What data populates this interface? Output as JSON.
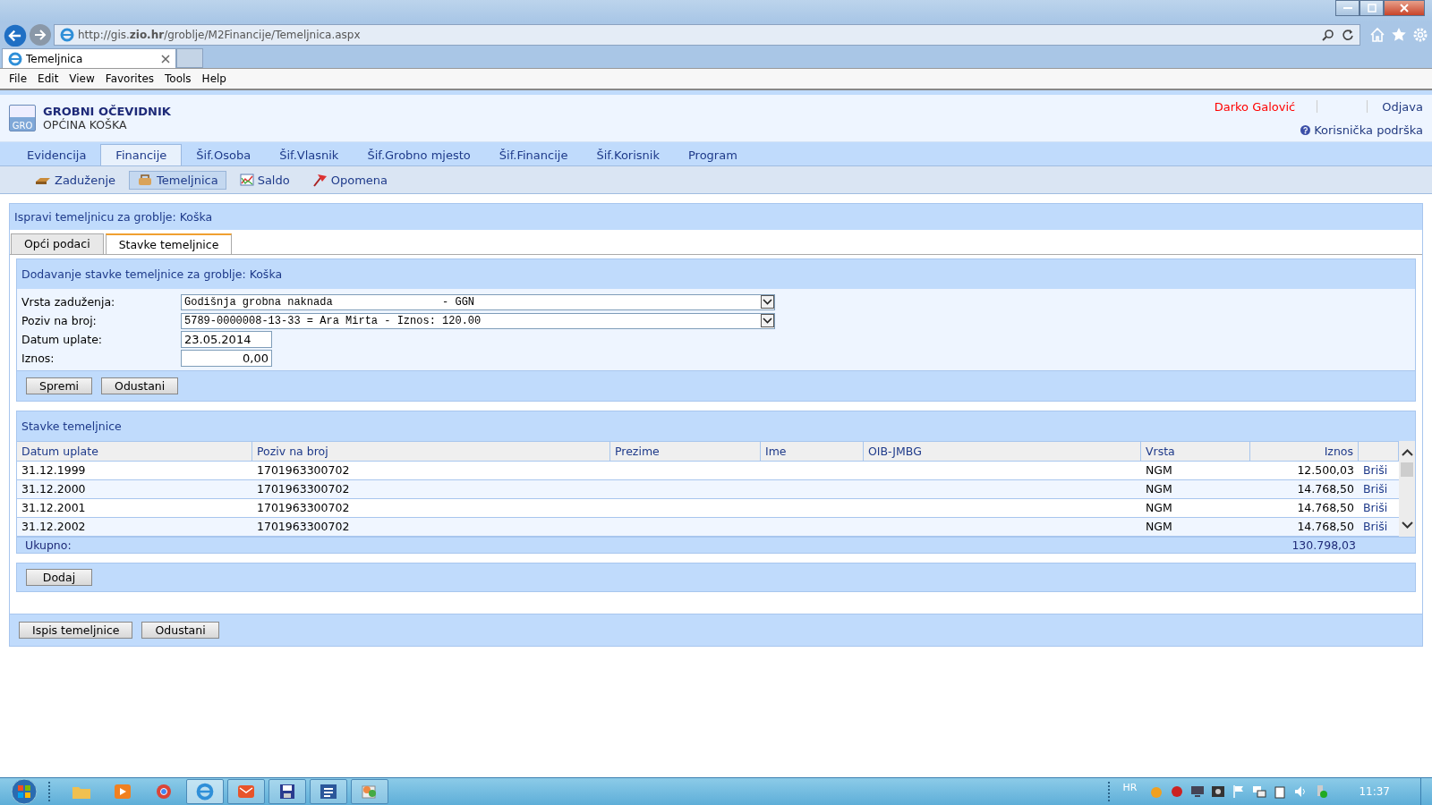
{
  "browser": {
    "url": "http://gis.**zio.hr**/groblje/M2Financije/Temeljnica.aspx",
    "tab_title": "Temeljnica",
    "menu": [
      "File",
      "Edit",
      "View",
      "Favorites",
      "Tools",
      "Help"
    ]
  },
  "app": {
    "title": "GROBNI OČEVIDNIK",
    "subtitle": "OPĆINA KOŠKA",
    "logo": "GRO",
    "user": "Darko Galović",
    "logout": "Odjava",
    "support": "Korisnička podrška"
  },
  "nav": [
    {
      "label": "Evidencija",
      "selected": false
    },
    {
      "label": "Financije",
      "selected": true
    },
    {
      "label": "Šif.Osoba",
      "selected": false
    },
    {
      "label": "Šif.Vlasnik",
      "selected": false
    },
    {
      "label": "Šif.Grobno mjesto",
      "selected": false
    },
    {
      "label": "Šif.Financije",
      "selected": false
    },
    {
      "label": "Šif.Korisnik",
      "selected": false
    },
    {
      "label": "Program",
      "selected": false
    }
  ],
  "subnav": [
    {
      "label": "Zaduženje",
      "selected": false
    },
    {
      "label": "Temeljnica",
      "selected": true
    },
    {
      "label": "Saldo",
      "selected": false
    },
    {
      "label": "Opomena",
      "selected": false
    }
  ],
  "page_title": "Ispravi temeljnicu za groblje: Koška",
  "tabs": [
    {
      "label": "Opći podaci",
      "selected": false
    },
    {
      "label": "Stavke temeljnice",
      "selected": true
    }
  ],
  "form": {
    "title": "Dodavanje stavke temeljnice za groblje: Koška",
    "fields": [
      {
        "label": "Vrsta zaduženja:",
        "kind": "select",
        "value": "Godišnja grobna naknada                 - GGN"
      },
      {
        "label": "Poziv na broj:",
        "kind": "select",
        "value": "5789-0000008-13-33 = Ara Mirta - Iznos: 120.00"
      },
      {
        "label": "Datum uplate:",
        "kind": "date",
        "value": "23.05.2014"
      },
      {
        "label": "Iznos:",
        "kind": "amount",
        "value": "0,00"
      }
    ],
    "buttons": [
      "Spremi",
      "Odustani"
    ]
  },
  "table": {
    "title": "Stavke temeljnice",
    "columns": [
      "Datum uplate",
      "Poziv na broj",
      "Prezime",
      "Ime",
      "OIB-JMBG",
      "Vrsta",
      "Iznos"
    ],
    "rows": [
      {
        "cells": [
          "31.12.1999",
          "1701963300702",
          "",
          "",
          "",
          "NGM",
          "12.500,03"
        ],
        "action": "Briši"
      },
      {
        "cells": [
          "31.12.2000",
          "1701963300702",
          "",
          "",
          "",
          "NGM",
          "14.768,50"
        ],
        "action": "Briši"
      },
      {
        "cells": [
          "31.12.2001",
          "1701963300702",
          "",
          "",
          "",
          "NGM",
          "14.768,50"
        ],
        "action": "Briši"
      },
      {
        "cells": [
          "31.12.2002",
          "1701963300702",
          "",
          "",
          "",
          "NGM",
          "14.768,50"
        ],
        "action": "Briši"
      }
    ],
    "total_label": "Ukupno:",
    "total": "130.798,03"
  },
  "add_button": "Dodaj",
  "footer_buttons": [
    "Ispis temeljnice",
    "Odustani"
  ],
  "taskbar": {
    "language": "HR",
    "time": "11:37"
  }
}
